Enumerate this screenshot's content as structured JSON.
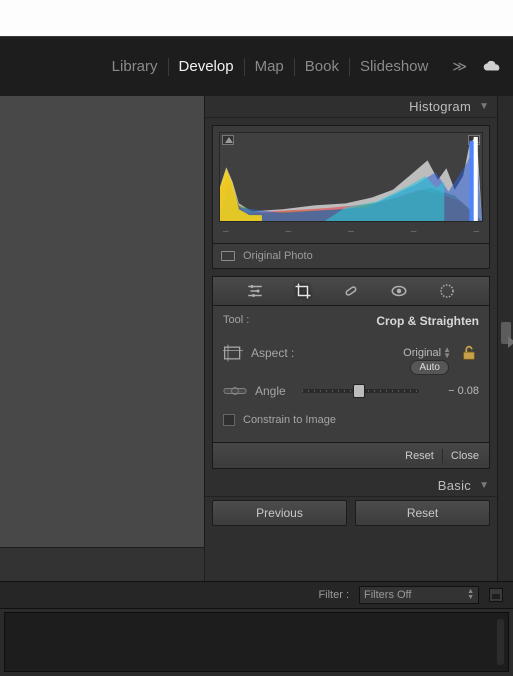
{
  "modules": {
    "items": [
      "Library",
      "Develop",
      "Map",
      "Book",
      "Slideshow"
    ],
    "active_index": 1
  },
  "panels": {
    "histogram": {
      "title": "Histogram",
      "ticks": [
        "–",
        "–",
        "–",
        "–",
        "–"
      ],
      "meta_label": "Original Photo"
    },
    "tool": {
      "label": "Tool :",
      "name": "Crop & Straighten",
      "aspect_label": "Aspect :",
      "aspect_value": "Original",
      "angle_label": "Angle",
      "angle_value": "− 0.08",
      "auto_label": "Auto",
      "constrain_label": "Constrain to Image",
      "reset_label": "Reset",
      "close_label": "Close",
      "slider_percent": 49
    },
    "basic": {
      "title": "Basic"
    },
    "buttons": {
      "previous": "Previous",
      "reset": "Reset"
    }
  },
  "bottom": {
    "filter_label": "Filter :",
    "filter_value": "Filters Off"
  },
  "icons": {
    "adjust": "adjust-icon",
    "crop": "crop-icon",
    "heal": "heal-icon",
    "redeye": "redeye-icon",
    "mask": "mask-icon"
  }
}
